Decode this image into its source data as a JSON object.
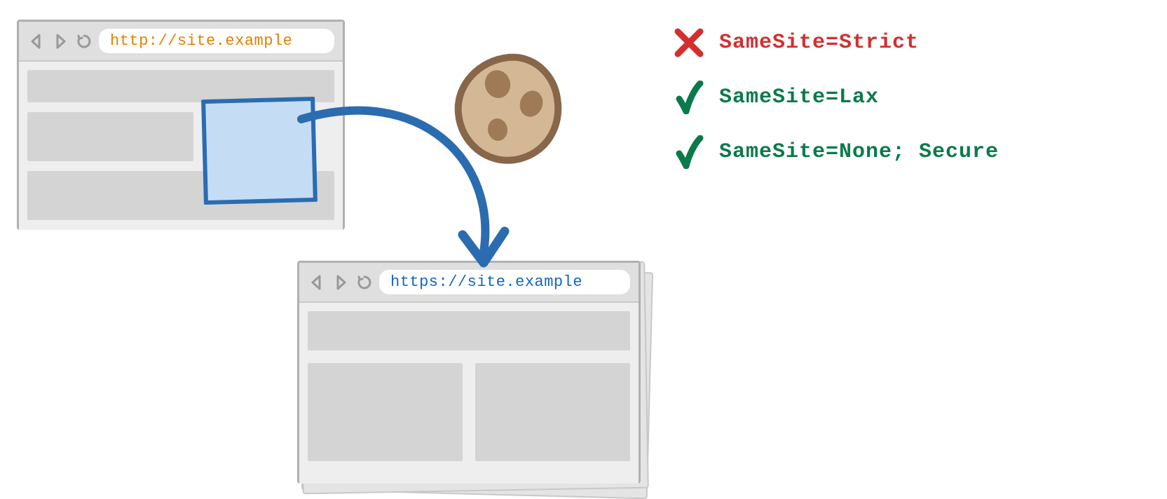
{
  "browser1": {
    "url": "http://site.example"
  },
  "browser2": {
    "url": "https://site.example"
  },
  "legend": {
    "strict": "SameSite=Strict",
    "lax": "SameSite=Lax",
    "none": "SameSite=None; Secure"
  }
}
